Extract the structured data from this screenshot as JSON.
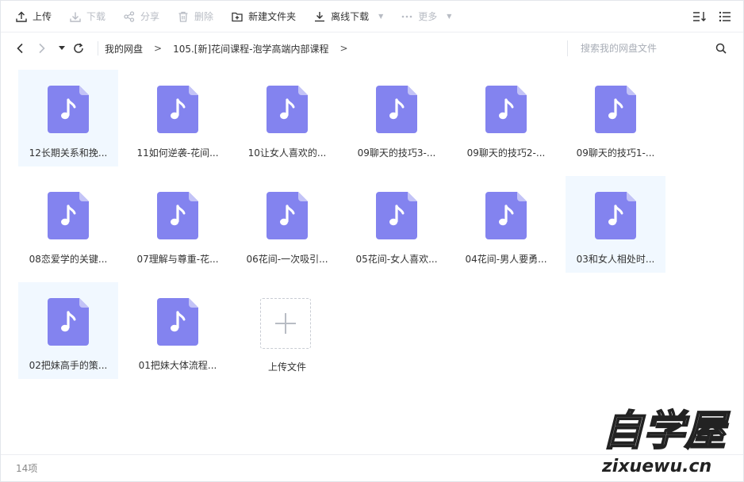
{
  "toolbar": {
    "upload": "上传",
    "download": "下载",
    "share": "分享",
    "delete": "删除",
    "new_folder": "新建文件夹",
    "offline_download": "离线下载",
    "more": "更多"
  },
  "nav": {
    "breadcrumbs": [
      "我的网盘",
      "105.[新]花间课程-泡学高端内部课程"
    ],
    "search_placeholder": "搜索我的网盘文件"
  },
  "files": [
    {
      "name": "12长期关系和挽...",
      "selected": true
    },
    {
      "name": "11如何逆袭-花间...",
      "selected": false
    },
    {
      "name": "10让女人喜欢的...",
      "selected": false
    },
    {
      "name": "09聊天的技巧3-...",
      "selected": false
    },
    {
      "name": "09聊天的技巧2-...",
      "selected": false
    },
    {
      "name": "09聊天的技巧1-...",
      "selected": false
    },
    {
      "name": "08恋爱学的关键...",
      "selected": false
    },
    {
      "name": "07理解与尊重-花...",
      "selected": false
    },
    {
      "name": "06花间-一次吸引...",
      "selected": false
    },
    {
      "name": "05花间-女人喜欢...",
      "selected": false
    },
    {
      "name": "04花间-男人要勇...",
      "selected": false
    },
    {
      "name": "03和女人相处时...",
      "selected": true
    },
    {
      "name": "02把妹高手的策...",
      "selected": true
    },
    {
      "name": "01把妹大体流程...",
      "selected": false
    }
  ],
  "upload_tile_label": "上传文件",
  "footer": {
    "count": "14项"
  },
  "watermark": {
    "text": "自学屋",
    "sub": "zixuewu.cn"
  },
  "colors": {
    "file_icon": "#8383ef",
    "selected_bg": "#f1f8ff",
    "accent": "#06a7ff"
  }
}
